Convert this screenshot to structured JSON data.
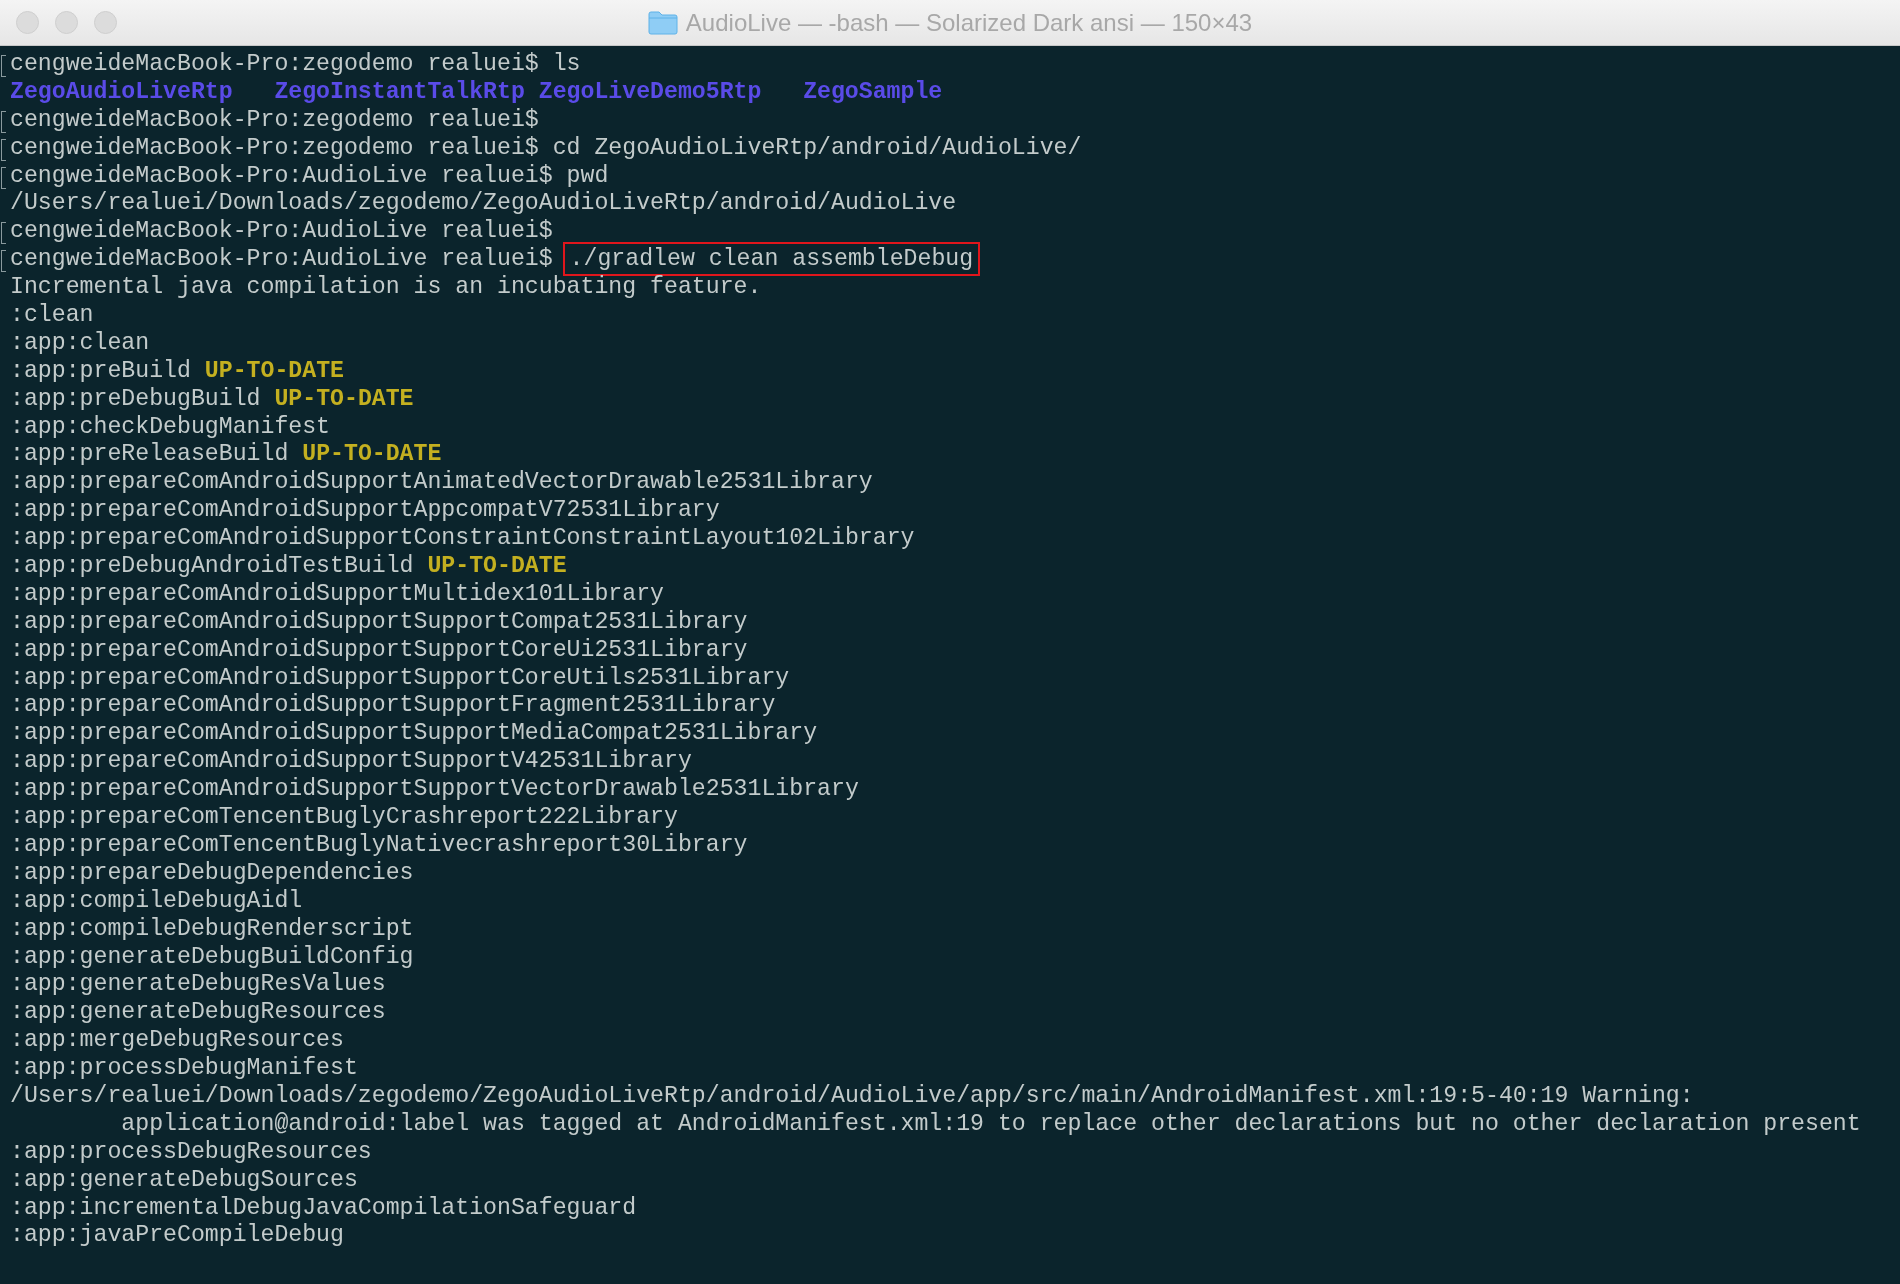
{
  "window": {
    "title": "AudioLive — -bash — Solarized Dark ansi — 150×43"
  },
  "lines": [
    {
      "marked": true,
      "segments": [
        {
          "kind": "plain",
          "text": "cengweideMacBook-Pro:zegodemo realuei$ ls"
        }
      ]
    },
    {
      "marked": false,
      "segments": [
        {
          "kind": "dir",
          "text": "ZegoAudioLiveRtp"
        },
        {
          "kind": "dir",
          "text": "ZegoInstantTalkRtp"
        },
        {
          "kind": "dir",
          "text": "ZegoLiveDemo5Rtp"
        },
        {
          "kind": "dir",
          "text": "ZegoSample"
        }
      ]
    },
    {
      "marked": true,
      "segments": [
        {
          "kind": "plain",
          "text": "cengweideMacBook-Pro:zegodemo realuei$"
        }
      ]
    },
    {
      "marked": true,
      "segments": [
        {
          "kind": "plain",
          "text": "cengweideMacBook-Pro:zegodemo realuei$ cd ZegoAudioLiveRtp/android/AudioLive/"
        }
      ]
    },
    {
      "marked": true,
      "segments": [
        {
          "kind": "plain",
          "text": "cengweideMacBook-Pro:AudioLive realuei$ pwd"
        }
      ]
    },
    {
      "marked": false,
      "segments": [
        {
          "kind": "plain",
          "text": "/Users/realuei/Downloads/zegodemo/ZegoAudioLiveRtp/android/AudioLive"
        }
      ]
    },
    {
      "marked": true,
      "segments": [
        {
          "kind": "plain",
          "text": "cengweideMacBook-Pro:AudioLive realuei$"
        }
      ]
    },
    {
      "marked": true,
      "segments": [
        {
          "kind": "plain",
          "text": "cengweideMacBook-Pro:AudioLive realuei$ "
        },
        {
          "kind": "plain",
          "text": "./gradlew clean assembleDebug",
          "highlighted": true
        }
      ]
    },
    {
      "marked": false,
      "segments": [
        {
          "kind": "plain",
          "text": "Incremental java compilation is an incubating feature."
        }
      ]
    },
    {
      "marked": false,
      "segments": [
        {
          "kind": "plain",
          "text": ":clean"
        }
      ]
    },
    {
      "marked": false,
      "segments": [
        {
          "kind": "plain",
          "text": ":app:clean"
        }
      ]
    },
    {
      "marked": false,
      "segments": [
        {
          "kind": "plain",
          "text": ":app:preBuild "
        },
        {
          "kind": "status",
          "text": "UP-TO-DATE"
        }
      ]
    },
    {
      "marked": false,
      "segments": [
        {
          "kind": "plain",
          "text": ":app:preDebugBuild "
        },
        {
          "kind": "status",
          "text": "UP-TO-DATE"
        }
      ]
    },
    {
      "marked": false,
      "segments": [
        {
          "kind": "plain",
          "text": ":app:checkDebugManifest"
        }
      ]
    },
    {
      "marked": false,
      "segments": [
        {
          "kind": "plain",
          "text": ":app:preReleaseBuild "
        },
        {
          "kind": "status",
          "text": "UP-TO-DATE"
        }
      ]
    },
    {
      "marked": false,
      "segments": [
        {
          "kind": "plain",
          "text": ":app:prepareComAndroidSupportAnimatedVectorDrawable2531Library"
        }
      ]
    },
    {
      "marked": false,
      "segments": [
        {
          "kind": "plain",
          "text": ":app:prepareComAndroidSupportAppcompatV72531Library"
        }
      ]
    },
    {
      "marked": false,
      "segments": [
        {
          "kind": "plain",
          "text": ":app:prepareComAndroidSupportConstraintConstraintLayout102Library"
        }
      ]
    },
    {
      "marked": false,
      "segments": [
        {
          "kind": "plain",
          "text": ":app:preDebugAndroidTestBuild "
        },
        {
          "kind": "status",
          "text": "UP-TO-DATE"
        }
      ]
    },
    {
      "marked": false,
      "segments": [
        {
          "kind": "plain",
          "text": ":app:prepareComAndroidSupportMultidex101Library"
        }
      ]
    },
    {
      "marked": false,
      "segments": [
        {
          "kind": "plain",
          "text": ":app:prepareComAndroidSupportSupportCompat2531Library"
        }
      ]
    },
    {
      "marked": false,
      "segments": [
        {
          "kind": "plain",
          "text": ":app:prepareComAndroidSupportSupportCoreUi2531Library"
        }
      ]
    },
    {
      "marked": false,
      "segments": [
        {
          "kind": "plain",
          "text": ":app:prepareComAndroidSupportSupportCoreUtils2531Library"
        }
      ]
    },
    {
      "marked": false,
      "segments": [
        {
          "kind": "plain",
          "text": ":app:prepareComAndroidSupportSupportFragment2531Library"
        }
      ]
    },
    {
      "marked": false,
      "segments": [
        {
          "kind": "plain",
          "text": ":app:prepareComAndroidSupportSupportMediaCompat2531Library"
        }
      ]
    },
    {
      "marked": false,
      "segments": [
        {
          "kind": "plain",
          "text": ":app:prepareComAndroidSupportSupportV42531Library"
        }
      ]
    },
    {
      "marked": false,
      "segments": [
        {
          "kind": "plain",
          "text": ":app:prepareComAndroidSupportSupportVectorDrawable2531Library"
        }
      ]
    },
    {
      "marked": false,
      "segments": [
        {
          "kind": "plain",
          "text": ":app:prepareComTencentBuglyCrashreport222Library"
        }
      ]
    },
    {
      "marked": false,
      "segments": [
        {
          "kind": "plain",
          "text": ":app:prepareComTencentBuglyNativecrashreport30Library"
        }
      ]
    },
    {
      "marked": false,
      "segments": [
        {
          "kind": "plain",
          "text": ":app:prepareDebugDependencies"
        }
      ]
    },
    {
      "marked": false,
      "segments": [
        {
          "kind": "plain",
          "text": ":app:compileDebugAidl"
        }
      ]
    },
    {
      "marked": false,
      "segments": [
        {
          "kind": "plain",
          "text": ":app:compileDebugRenderscript"
        }
      ]
    },
    {
      "marked": false,
      "segments": [
        {
          "kind": "plain",
          "text": ":app:generateDebugBuildConfig"
        }
      ]
    },
    {
      "marked": false,
      "segments": [
        {
          "kind": "plain",
          "text": ":app:generateDebugResValues"
        }
      ]
    },
    {
      "marked": false,
      "segments": [
        {
          "kind": "plain",
          "text": ":app:generateDebugResources"
        }
      ]
    },
    {
      "marked": false,
      "segments": [
        {
          "kind": "plain",
          "text": ":app:mergeDebugResources"
        }
      ]
    },
    {
      "marked": false,
      "segments": [
        {
          "kind": "plain",
          "text": ":app:processDebugManifest"
        }
      ]
    },
    {
      "marked": false,
      "segments": [
        {
          "kind": "plain",
          "text": "/Users/realuei/Downloads/zegodemo/ZegoAudioLiveRtp/android/AudioLive/app/src/main/AndroidManifest.xml:19:5-40:19 Warning:"
        }
      ]
    },
    {
      "marked": false,
      "segments": [
        {
          "kind": "plain",
          "text": "        application@android:label was tagged at AndroidManifest.xml:19 to replace other declarations but no other declaration present"
        }
      ]
    },
    {
      "marked": false,
      "segments": [
        {
          "kind": "plain",
          "text": ":app:processDebugResources"
        }
      ]
    },
    {
      "marked": false,
      "segments": [
        {
          "kind": "plain",
          "text": ":app:generateDebugSources"
        }
      ]
    },
    {
      "marked": false,
      "segments": [
        {
          "kind": "plain",
          "text": ":app:incrementalDebugJavaCompilationSafeguard"
        }
      ]
    },
    {
      "marked": false,
      "segments": [
        {
          "kind": "plain",
          "text": ":app:javaPreCompileDebug"
        }
      ]
    }
  ]
}
